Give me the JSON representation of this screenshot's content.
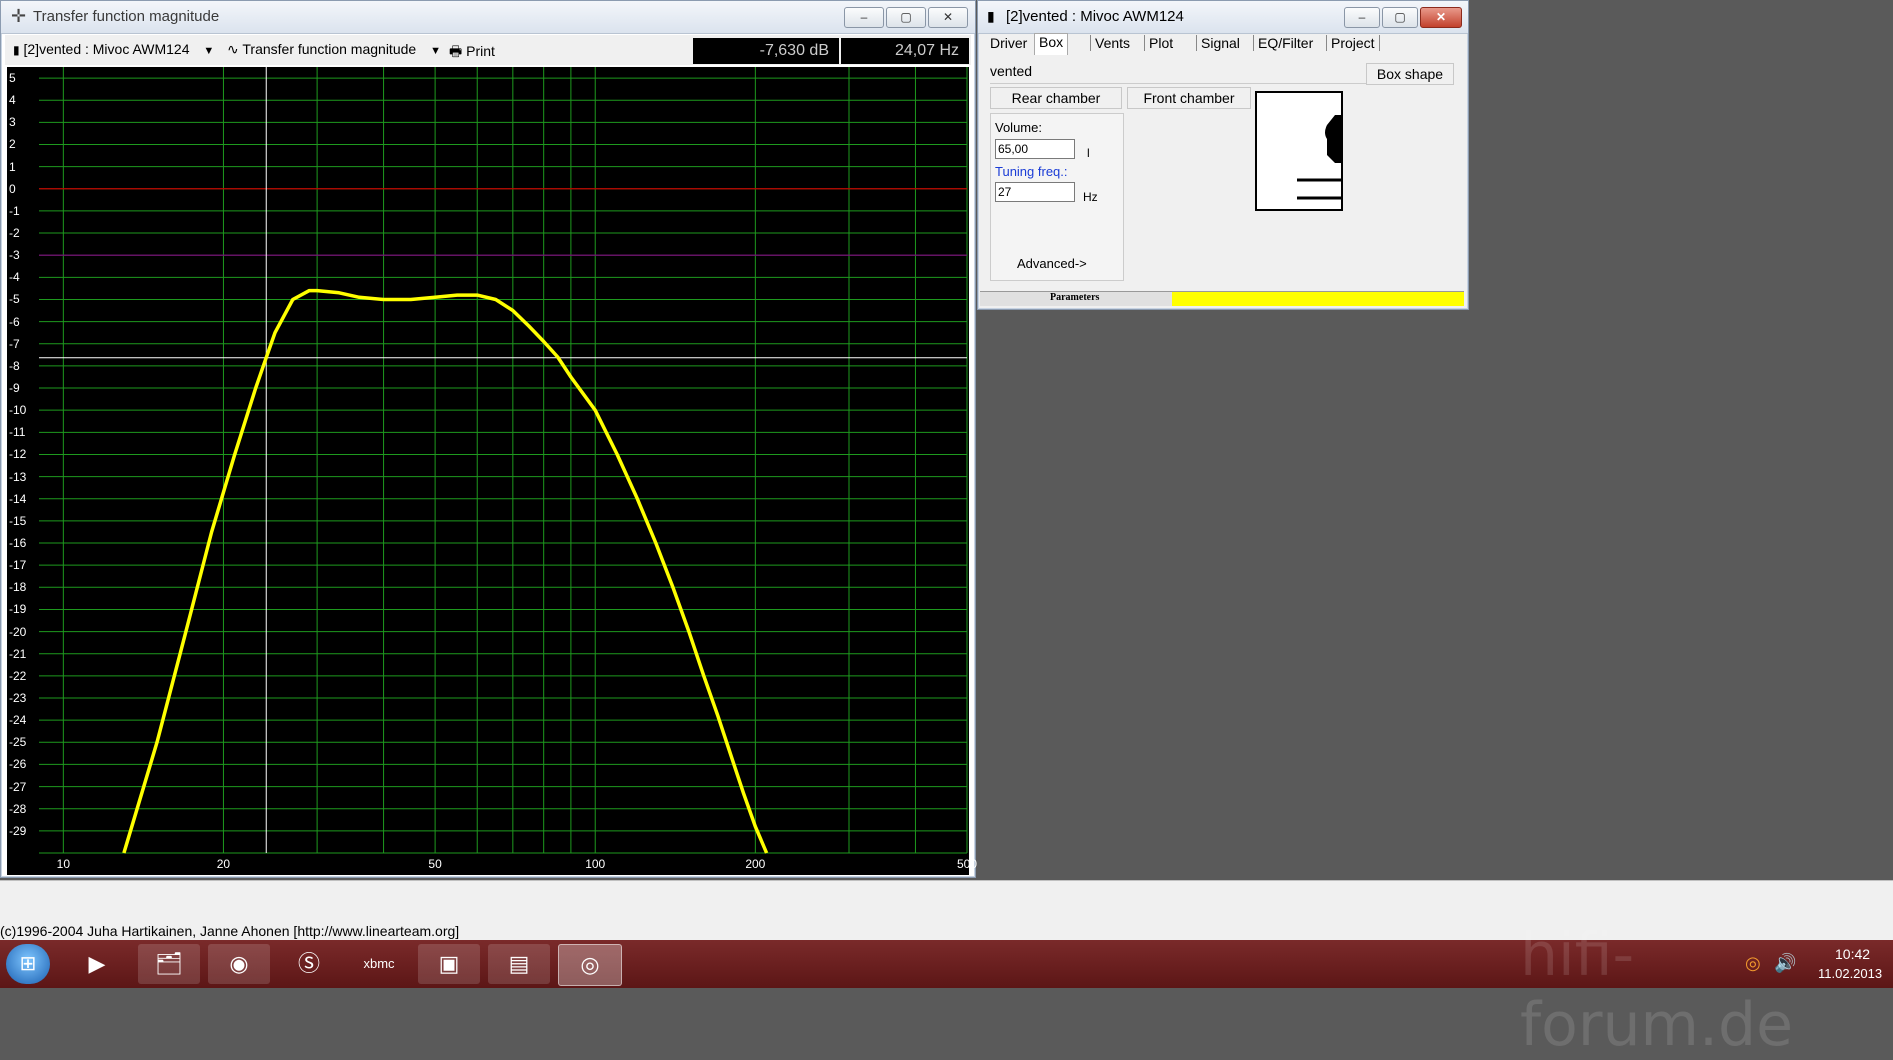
{
  "plot_window": {
    "title": "Transfer function magnitude",
    "toolbar": {
      "system_selector": "[2]vented : Mivoc AWM124",
      "function_selector": "Transfer function magnitude",
      "print_label": "Print"
    },
    "readout": {
      "db": "-7,630 dB",
      "hz": "24,07 Hz"
    },
    "window_buttons": {
      "minimize": "–",
      "maximize": "▢",
      "close": "✕"
    }
  },
  "chart_data": {
    "type": "line",
    "x_scale": "log",
    "xlim": [
      9,
      500
    ],
    "ylim": [
      -30,
      5.5
    ],
    "x_ticks": [
      "10",
      "20",
      "50",
      "100",
      "200",
      "500"
    ],
    "x_tick_values": [
      10,
      20,
      50,
      100,
      200,
      500
    ],
    "y_ticks": [
      "5",
      "4",
      "3",
      "2",
      "1",
      "0",
      "-1",
      "-2",
      "-3",
      "-4",
      "-5",
      "-6",
      "-7",
      "-8",
      "-9",
      "-10",
      "-11",
      "-12",
      "-13",
      "-14",
      "-15",
      "-16",
      "-17",
      "-18",
      "-19",
      "-20",
      "-21",
      "-22",
      "-23",
      "-24",
      "-25",
      "-26",
      "-27",
      "-28",
      "-29"
    ],
    "grid": true,
    "reference_lines": [
      {
        "y": 0,
        "color": "#c00000"
      },
      {
        "y": -3,
        "color": "#800080"
      }
    ],
    "cursor": {
      "x": 24.07,
      "y": -7.63,
      "color": "#ffffff"
    },
    "series": [
      {
        "color": "#ffff00",
        "x": [
          13,
          15,
          17,
          19,
          21,
          23,
          24.07,
          25,
          27,
          29,
          30,
          33,
          36,
          40,
          45,
          50,
          55,
          60,
          65,
          70,
          75,
          80,
          85,
          90,
          100,
          110,
          120,
          130,
          140,
          150,
          160,
          170,
          180,
          190,
          200,
          210
        ],
        "y": [
          -30,
          -25,
          -20,
          -15.5,
          -12,
          -9,
          -7.63,
          -6.5,
          -5,
          -4.6,
          -4.6,
          -4.7,
          -4.9,
          -5,
          -5,
          -4.9,
          -4.8,
          -4.8,
          -5,
          -5.5,
          -6.2,
          -6.9,
          -7.6,
          -8.5,
          -10,
          -12,
          -14,
          -16,
          -18,
          -20,
          -22,
          -23.8,
          -25.6,
          -27.3,
          -28.8,
          -30
        ]
      }
    ]
  },
  "params_window": {
    "title": "[2]vented :  Mivoc AWM124",
    "tabs": [
      "Driver",
      "Box",
      "Vents",
      "Plot",
      "Signal",
      "EQ/Filter",
      "Project"
    ],
    "box_type": "vented",
    "box_shape_button": "Box shape",
    "rear_chamber_button": "Rear chamber",
    "front_chamber_button": "Front chamber",
    "volume_label": "Volume:",
    "volume_value": "65,00",
    "volume_unit": "l",
    "tuning_label": "Tuning freq.:",
    "tuning_value": "27",
    "tuning_unit": "Hz",
    "advanced_button": "Advanced->",
    "status_label": "Parameters",
    "window_buttons": {
      "minimize": "–",
      "maximize": "▢",
      "close": "✕"
    }
  },
  "status_bar": {
    "copyright": "(c)1996-2004 Juha Hartikainen, Janne Ahonen [http://www.linearteam.org]"
  },
  "taskbar": {
    "clock_time": "10:42",
    "clock_date": "11.02.2013",
    "watermark": "hifi-forum.de"
  }
}
